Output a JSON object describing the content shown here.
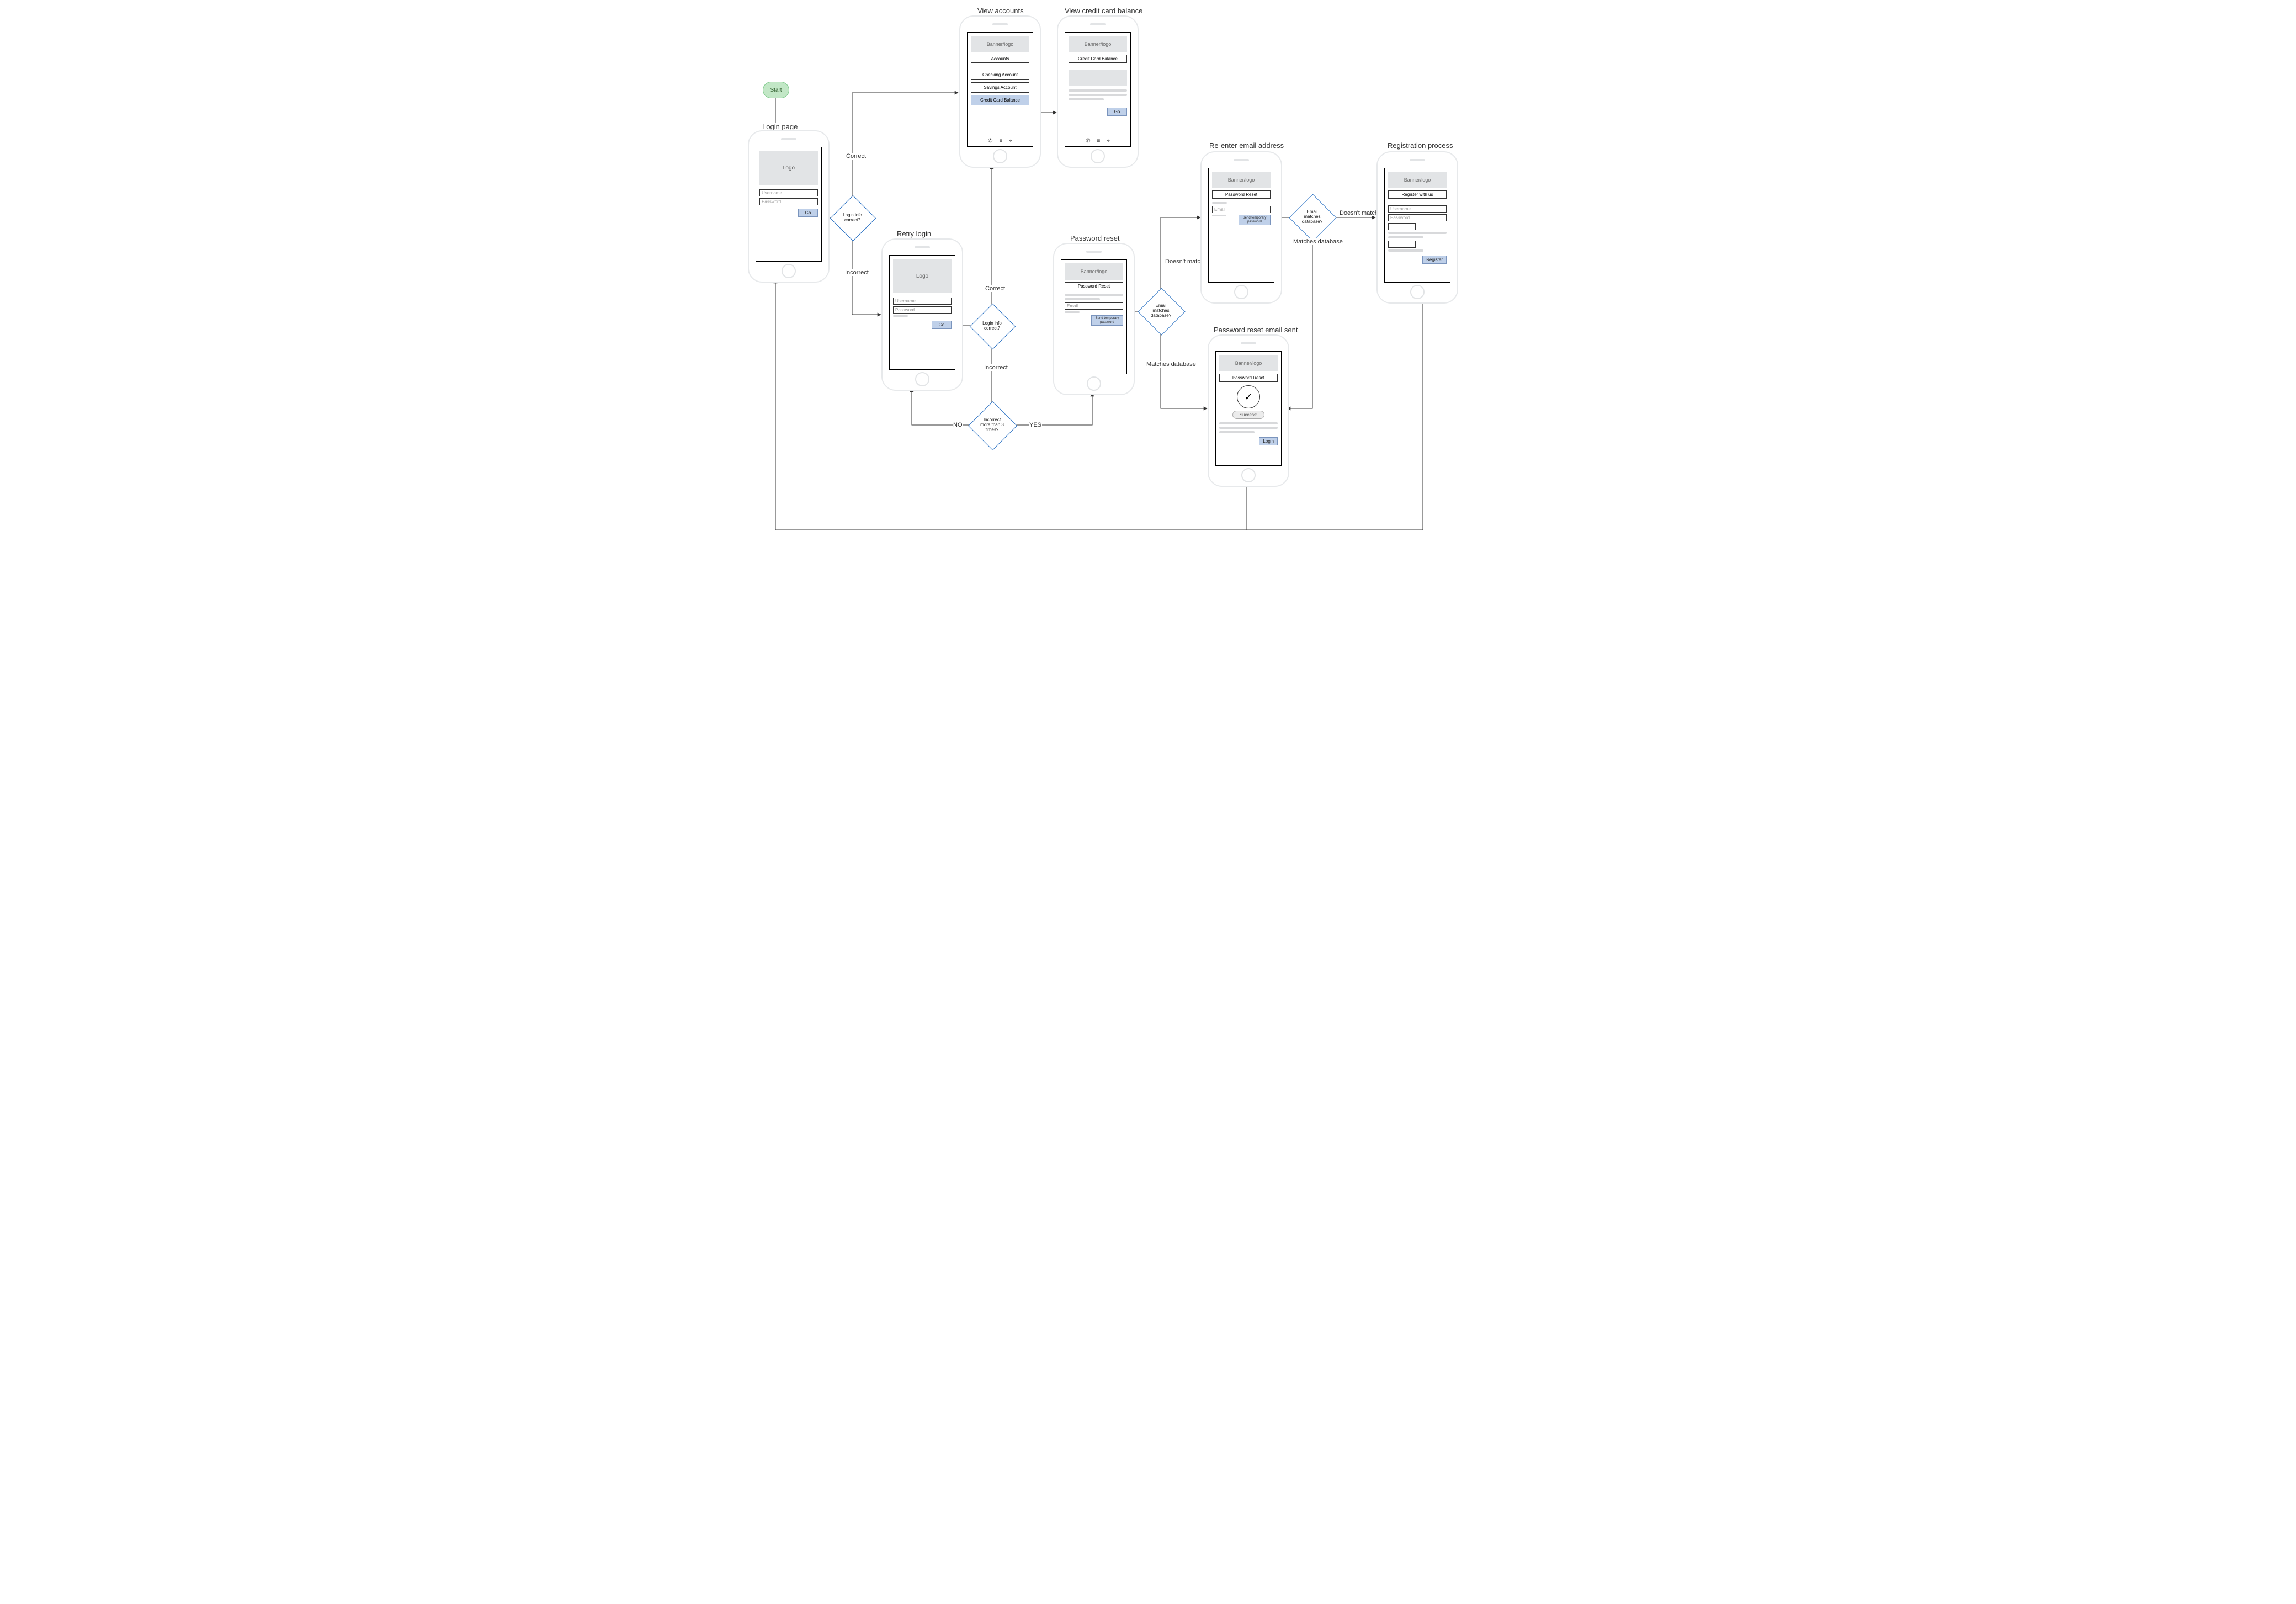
{
  "start": {
    "label": "Start"
  },
  "titles": {
    "login": "Login page",
    "retry": "Retry login",
    "accounts": "View accounts",
    "ccbal": "View credit card balance",
    "pwreset": "Password reset",
    "reenter": "Re-enter email address",
    "regproc": "Registration process",
    "pwsent": "Password reset email sent"
  },
  "decisions": {
    "d1": "Login info correct?",
    "d2": "Login info correct?",
    "d3": "Incorrect more than 3 times?",
    "d4": "Email matches database?",
    "d5": "Email matches database?"
  },
  "edges": {
    "correct": "Correct",
    "incorrect": "Incorrect",
    "yes": "YES",
    "no": "NO",
    "matches": "Matches database",
    "nomatch": "Doesn't match database",
    "nomatch2": "Doesn't match database"
  },
  "common": {
    "banner": "Banner/logo",
    "logo": "Logo",
    "username": "Username",
    "password": "Password",
    "email": "Email",
    "go": "Go",
    "sendTemp": "Send temporary password",
    "login": "Login",
    "register": "Register",
    "success": "Success!"
  },
  "screens": {
    "accounts": {
      "title": "Accounts",
      "items": [
        "Checking Account",
        "Savings Account",
        "Credit Card Balance"
      ]
    },
    "ccbal": {
      "title": "Credit Card Balance"
    },
    "pwreset": {
      "title": "Password Reset"
    },
    "reenter": {
      "title": "Password Reset"
    },
    "pwsent": {
      "title": "Password Reset"
    },
    "register": {
      "title": "Register with us"
    }
  }
}
